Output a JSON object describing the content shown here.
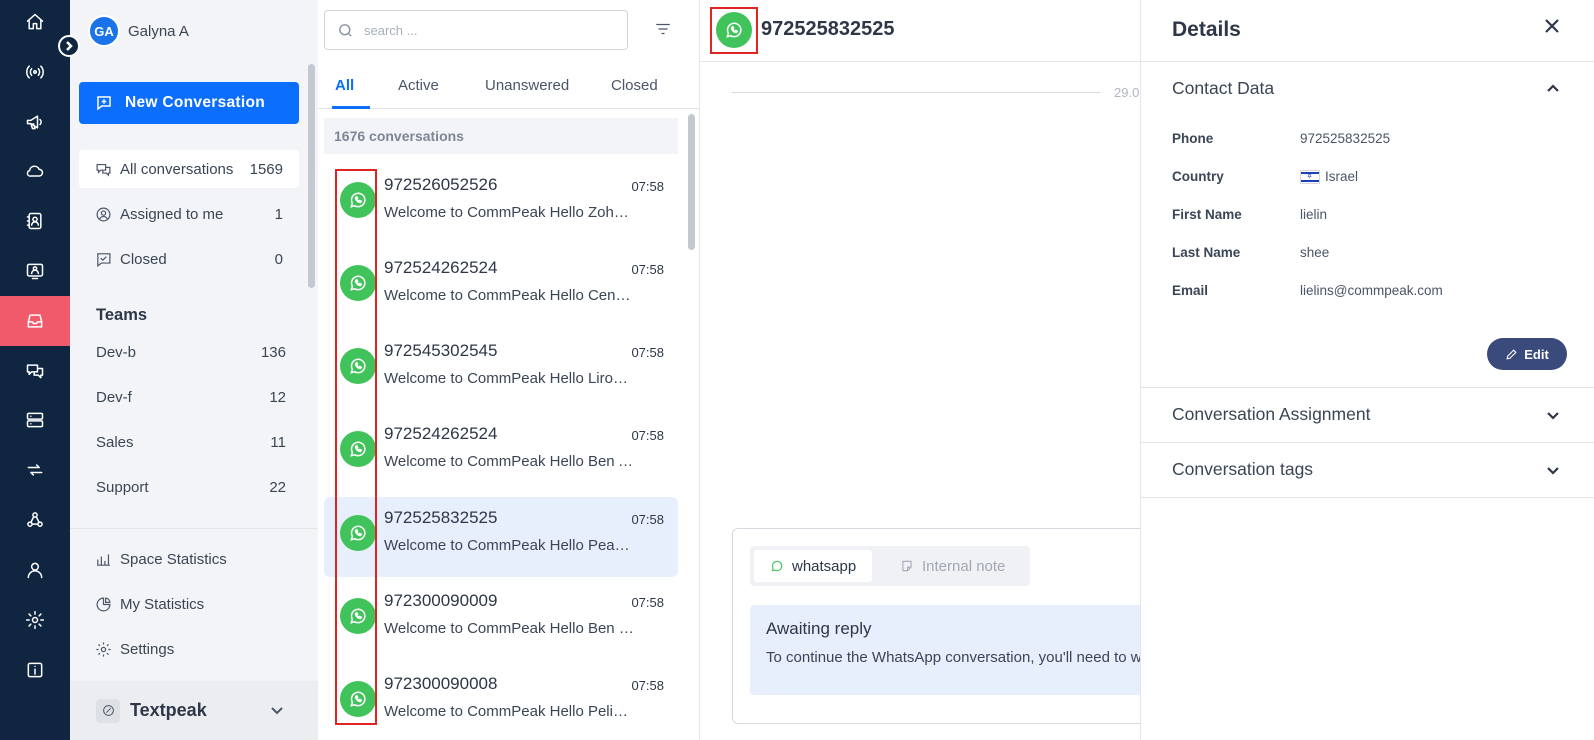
{
  "rail": {
    "items": [
      {
        "icon": "home-icon"
      },
      {
        "icon": "broadcast-icon"
      },
      {
        "icon": "megaphone-icon"
      },
      {
        "icon": "cloud-icon"
      },
      {
        "icon": "contacts-book-icon"
      },
      {
        "icon": "agent-icon"
      },
      {
        "icon": "inbox-icon",
        "active": true
      },
      {
        "icon": "chat-bubbles-icon"
      },
      {
        "icon": "server-icon"
      },
      {
        "icon": "sync-icon"
      },
      {
        "icon": "webhook-icon"
      },
      {
        "icon": "user-icon"
      },
      {
        "icon": "settings-icon"
      },
      {
        "icon": "info-icon"
      }
    ],
    "active_color": "#f05a6b",
    "background": "#0f2540"
  },
  "nav": {
    "user": {
      "initials": "GA",
      "name": "Galyna A"
    },
    "new_conversation_label": "New Conversation",
    "filters": [
      {
        "label": "All conversations",
        "count": "1569"
      },
      {
        "label": "Assigned to me",
        "count": "1"
      },
      {
        "label": "Closed",
        "count": "0"
      }
    ],
    "teams_title": "Teams",
    "teams": [
      {
        "label": "Dev-b",
        "count": "136"
      },
      {
        "label": "Dev-f",
        "count": "12"
      },
      {
        "label": "Sales",
        "count": "11"
      },
      {
        "label": "Support",
        "count": "22"
      }
    ],
    "links": [
      {
        "label": "Space Statistics"
      },
      {
        "label": "My Statistics"
      },
      {
        "label": "Settings"
      }
    ],
    "workspace": "Textpeak"
  },
  "list": {
    "search_placeholder": "search ...",
    "tabs": [
      "All",
      "Active",
      "Unanswered",
      "Closed"
    ],
    "active_tab": "All",
    "count_text": "1676 conversations",
    "conversations": [
      {
        "phone": "972526052526",
        "time": "07:58",
        "message": "Welcome to CommPeak Hello Zohar Levi"
      },
      {
        "phone": "972524262524",
        "time": "07:58",
        "message": "Welcome to CommPeak Hello Cen cen"
      },
      {
        "phone": "972545302545",
        "time": "07:58",
        "message": "Welcome to CommPeak Hello Liron Ab"
      },
      {
        "phone": "972524262524",
        "time": "07:58",
        "message": "Welcome to CommPeak Hello Ben Aharon"
      },
      {
        "phone": "972525832525",
        "time": "07:58",
        "message": "Welcome to CommPeak Hello Pean Ohana",
        "selected": true
      },
      {
        "phone": "972300090009",
        "time": "07:58",
        "message": "Welcome to CommPeak Hello Ben Levi"
      },
      {
        "phone": "972300090008",
        "time": "07:58",
        "message": "Welcome to CommPeak Hello Pelikan"
      }
    ]
  },
  "chat": {
    "phone": "972525832525",
    "date_text": "29.0",
    "composer_tabs": [
      {
        "label": "whatsapp",
        "icon": "whatsapp-icon"
      },
      {
        "label": "Internal note",
        "icon": "note-icon"
      }
    ],
    "awaiting_title": "Awaiting reply",
    "awaiting_text": "To continue the WhatsApp conversation, you'll need to wait for the customer to reply."
  },
  "details": {
    "title": "Details",
    "contact_section": "Contact Data",
    "fields": [
      {
        "label": "Phone",
        "value": "972525832525"
      },
      {
        "label": "Country",
        "value": "Israel"
      },
      {
        "label": "First Name",
        "value": "lielin"
      },
      {
        "label": "Last Name",
        "value": "shee"
      },
      {
        "label": "Email",
        "value": "lielins@commpeak.com"
      }
    ],
    "edit_label": "Edit",
    "sections": [
      "Conversation Assignment",
      "Conversation tags"
    ]
  },
  "colors": {
    "primary": "#0b6efd",
    "whatsapp_green": "#3fc35a",
    "highlight_box": "#e02424",
    "selected_row": "#e8effc"
  }
}
